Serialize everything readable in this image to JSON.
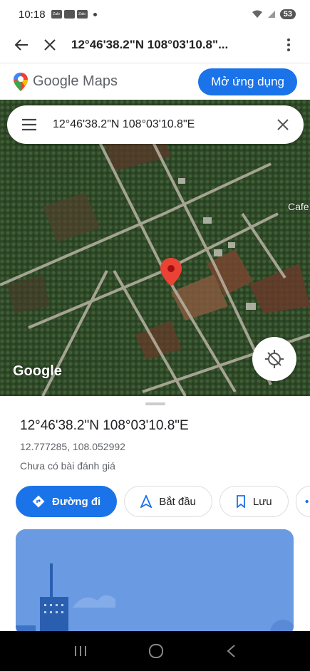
{
  "status_bar": {
    "time": "10:18",
    "notif_chips": [
      "Zalo",
      "",
      "Zalo"
    ],
    "battery": "53"
  },
  "browser": {
    "title": "12°46'38.2\"N 108°03'10.8\"..."
  },
  "maps_banner": {
    "brand": "Google Maps",
    "open_app_label": "Mở ứng dụng",
    "accent": "#1a73e8"
  },
  "map": {
    "search_query": "12°46'38.2\"N 108°03'10.8\"E",
    "place_label": "Cafe",
    "watermark": "Google",
    "pin_color": "#ea4335"
  },
  "place": {
    "title": "12°46'38.2\"N 108°03'10.8\"E",
    "decimal_coords": "12.777285, 108.052992",
    "reviews": "Chưa có bài đánh giá"
  },
  "actions": {
    "directions": "Đường đi",
    "start": "Bắt đầu",
    "save": "Lưu"
  }
}
